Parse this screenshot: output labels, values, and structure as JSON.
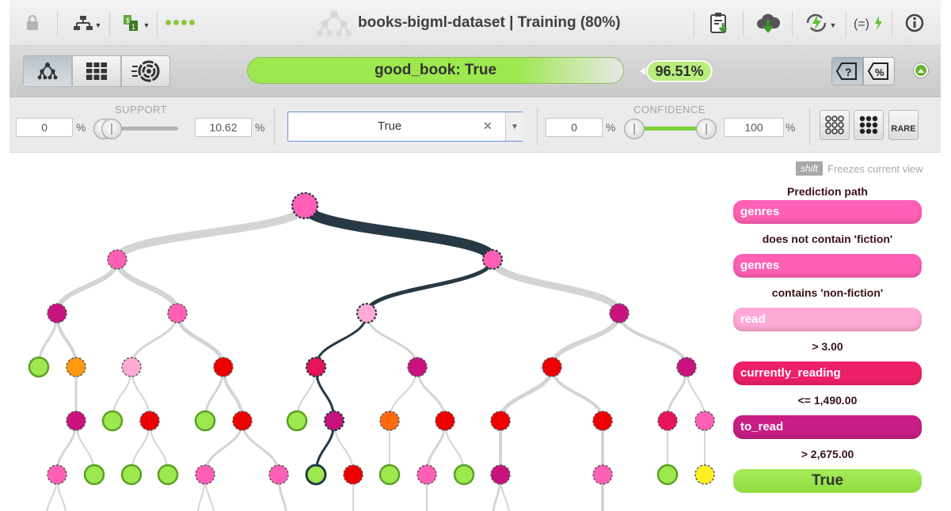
{
  "header": {
    "title": "books-bigml-dataset | Training (80%)",
    "icons": [
      "lock-icon",
      "tree-structure-icon",
      "dataset-icon",
      "status-dots-icon",
      "model-logo-icon",
      "clipboard-download-icon",
      "cloud-download-icon",
      "lightning-actions-icon",
      "formula-icon",
      "info-icon"
    ]
  },
  "views": {
    "items": [
      "tree-view-icon",
      "table-view-icon",
      "sunburst-view-icon"
    ],
    "active": 0
  },
  "prediction": {
    "label": "good_book: True",
    "confidence": "96.51%",
    "confidence_fraction": 0.9651,
    "mode_buttons": [
      "question-mode-icon",
      "percent-mode-icon"
    ]
  },
  "filters": {
    "support_label": "SUPPORT",
    "support_min": "0",
    "support_max": "10.62",
    "pct": "%",
    "selected_class": "True",
    "confidence_label": "CONFIDENCE",
    "confidence_min": "0",
    "confidence_max": "100",
    "rare_label": "RARE"
  },
  "shift_hint": {
    "key": "shift",
    "text": "Freezes current view"
  },
  "prediction_path": {
    "title": "Prediction path",
    "steps": [
      {
        "field": "genres",
        "condition": "does not contain 'fiction'",
        "color": "#ff5fb4"
      },
      {
        "field": "genres",
        "condition": "contains 'non-fiction'",
        "color": "#ff5fb4"
      },
      {
        "field": "read",
        "condition": "> 3.00",
        "color": "#ffaad6"
      },
      {
        "field": "currently_reading",
        "condition": "<= 1,490.00",
        "color": "#ee1f69"
      },
      {
        "field": "to_read",
        "condition": "> 2,675.00",
        "color": "#c81d85"
      }
    ],
    "result": "True"
  },
  "colors": {
    "path": "#263944",
    "branch": "#d4d4d4",
    "green_leaf": "#9ee84f",
    "accent_green": "#7ad13a"
  }
}
